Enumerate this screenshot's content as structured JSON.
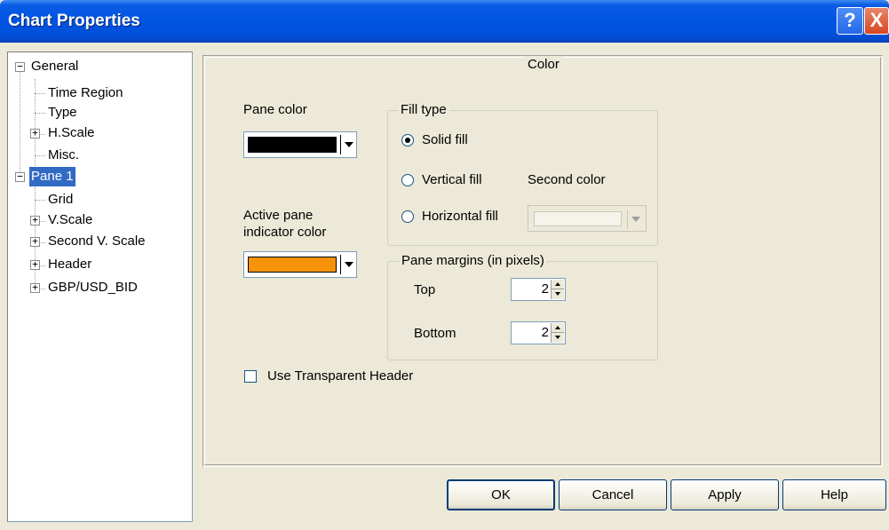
{
  "window": {
    "title": "Chart Properties",
    "help_glyph": "?",
    "close_glyph": "X"
  },
  "tree": {
    "items": [
      {
        "label": "General",
        "expander": "−"
      },
      {
        "label": "Time Region"
      },
      {
        "label": "Type"
      },
      {
        "label": "H.Scale",
        "expander": "+"
      },
      {
        "label": "Misc."
      },
      {
        "label": "Pane 1",
        "expander": "−",
        "selected": true
      },
      {
        "label": "Grid"
      },
      {
        "label": "V.Scale",
        "expander": "+"
      },
      {
        "label": "Second V. Scale",
        "expander": "+"
      },
      {
        "label": "Header",
        "expander": "+"
      },
      {
        "label": "GBP/USD_BID",
        "expander": "+"
      }
    ]
  },
  "panel": {
    "title": "Color",
    "pane_color_label": "Pane color",
    "pane_color": "#000000",
    "active_indicator_label_line1": "Active pane",
    "active_indicator_label_line2": "indicator color",
    "active_indicator_color": "#f7930a",
    "fill_type": {
      "title": "Fill type",
      "options": [
        "Solid fill",
        "Vertical fill",
        "Horizontal fill"
      ],
      "selected": "Solid fill",
      "second_color_label": "Second color"
    },
    "margins": {
      "title": "Pane margins (in pixels)",
      "top_label": "Top",
      "top_value": "2",
      "bottom_label": "Bottom",
      "bottom_value": "2"
    },
    "transparent_header_label": "Use Transparent Header",
    "transparent_header_checked": false
  },
  "buttons": {
    "ok": "OK",
    "cancel": "Cancel",
    "apply": "Apply",
    "help": "Help"
  }
}
